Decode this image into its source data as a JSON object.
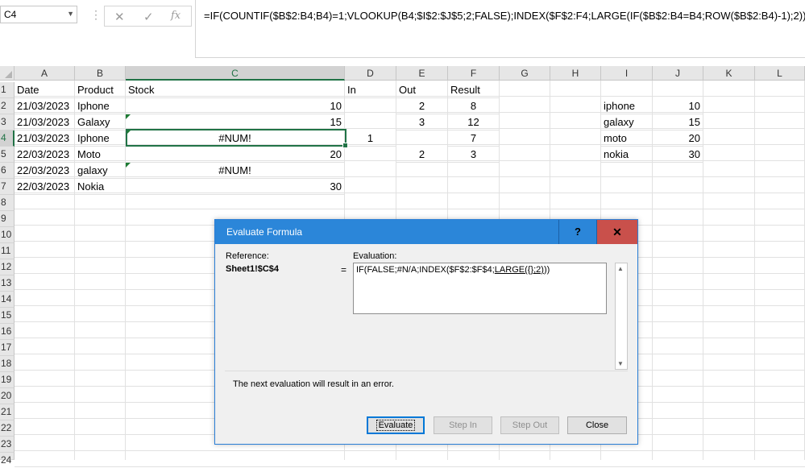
{
  "name_box": {
    "value": "C4"
  },
  "formula_bar": {
    "cancel_icon": "✕",
    "enter_icon": "✓",
    "fx_label": "fx",
    "formula": "=IF(COUNTIF($B$2:B4;B4)=1;VLOOKUP(B4;$I$2:$J$5;2;FALSE);INDEX($F$2:F4;LARGE(IF($B$2:B4=B4;ROW($B$2:B4)-1);2)))"
  },
  "columns": [
    "A",
    "B",
    "C",
    "D",
    "E",
    "F",
    "G",
    "H",
    "I",
    "J",
    "K",
    "L"
  ],
  "rows": [
    "1",
    "2",
    "3",
    "4",
    "5",
    "6",
    "7",
    "8",
    "9",
    "10",
    "11",
    "12",
    "13",
    "14",
    "15",
    "16",
    "17",
    "18",
    "19",
    "20",
    "21",
    "22",
    "23",
    "24"
  ],
  "cells": {
    "header": {
      "date": "Date",
      "product": "Product",
      "stock": "Stock",
      "in": "In",
      "out": "Out",
      "result": "Result"
    },
    "r2": {
      "date": "21/03/2023",
      "product": "Iphone",
      "stock": "10",
      "out": "2",
      "result": "8",
      "lookup_name": "iphone",
      "lookup_value": "10"
    },
    "r3": {
      "date": "21/03/2023",
      "product": "Galaxy",
      "stock": "15",
      "out": "3",
      "result": "12",
      "lookup_name": "galaxy",
      "lookup_value": "15"
    },
    "r4": {
      "date": "21/03/2023",
      "product": "Iphone",
      "stock": "#NUM!",
      "in": "1",
      "result": "7",
      "lookup_name": "moto",
      "lookup_value": "20"
    },
    "r5": {
      "date": "22/03/2023",
      "product": "Moto",
      "stock": "20",
      "out": "2",
      "result": "3",
      "lookup_name": "nokia",
      "lookup_value": "30"
    },
    "r6": {
      "date": "22/03/2023",
      "product": "galaxy",
      "stock": "#NUM!"
    },
    "r7": {
      "date": "22/03/2023",
      "product": "Nokia",
      "stock": "30"
    }
  },
  "dialog": {
    "title": "Evaluate Formula",
    "help": "?",
    "close": "✕",
    "reference_label": "Reference:",
    "evaluation_label": "Evaluation:",
    "reference_value": "Sheet1!$C$4",
    "equals": "=",
    "evaluation_prefix": "IF(FALSE;#N/A;INDEX($F$2:$F$4;",
    "evaluation_underlined": "LARGE({};2)",
    "evaluation_suffix": "))",
    "message": "The next evaluation will result in an error.",
    "buttons": {
      "evaluate": "Evaluate",
      "step_in": "Step In",
      "step_out": "Step Out",
      "close": "Close"
    }
  }
}
